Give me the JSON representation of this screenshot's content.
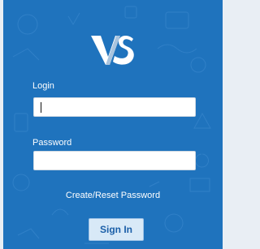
{
  "brand": {
    "logo_icon": "vs-logo-icon",
    "primary_color": "#1f73bd",
    "logo_accent": "#a9c4de"
  },
  "login": {
    "label": "Login",
    "value": "",
    "placeholder": ""
  },
  "password": {
    "label": "Password",
    "value": "",
    "placeholder": ""
  },
  "links": {
    "reset_password": "Create/Reset Password"
  },
  "actions": {
    "sign_in": "Sign In"
  }
}
